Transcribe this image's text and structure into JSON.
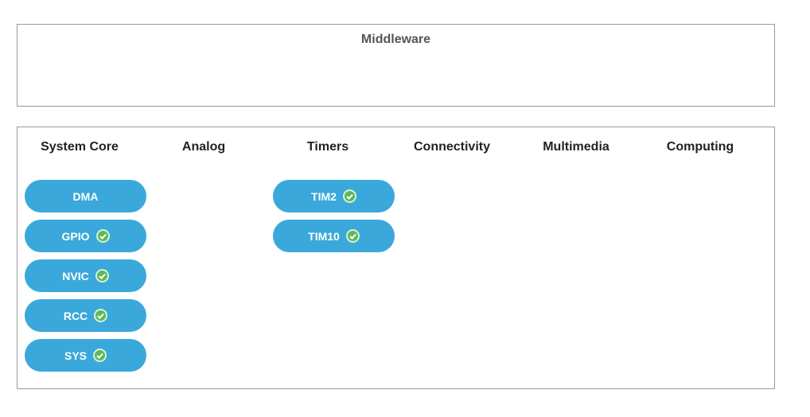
{
  "middleware": {
    "title": "Middleware"
  },
  "columns": [
    {
      "title": "System Core",
      "items": [
        {
          "label": "DMA",
          "checked": false
        },
        {
          "label": "GPIO",
          "checked": true
        },
        {
          "label": "NVIC",
          "checked": true
        },
        {
          "label": "RCC",
          "checked": true
        },
        {
          "label": "SYS",
          "checked": true
        }
      ]
    },
    {
      "title": "Analog",
      "items": []
    },
    {
      "title": "Timers",
      "items": [
        {
          "label": "TIM2",
          "checked": true
        },
        {
          "label": "TIM10",
          "checked": true
        }
      ]
    },
    {
      "title": "Connectivity",
      "items": []
    },
    {
      "title": "Multimedia",
      "items": []
    },
    {
      "title": "Computing",
      "items": []
    }
  ],
  "colors": {
    "button": "#3aa8da",
    "check": "#5cb85c"
  }
}
